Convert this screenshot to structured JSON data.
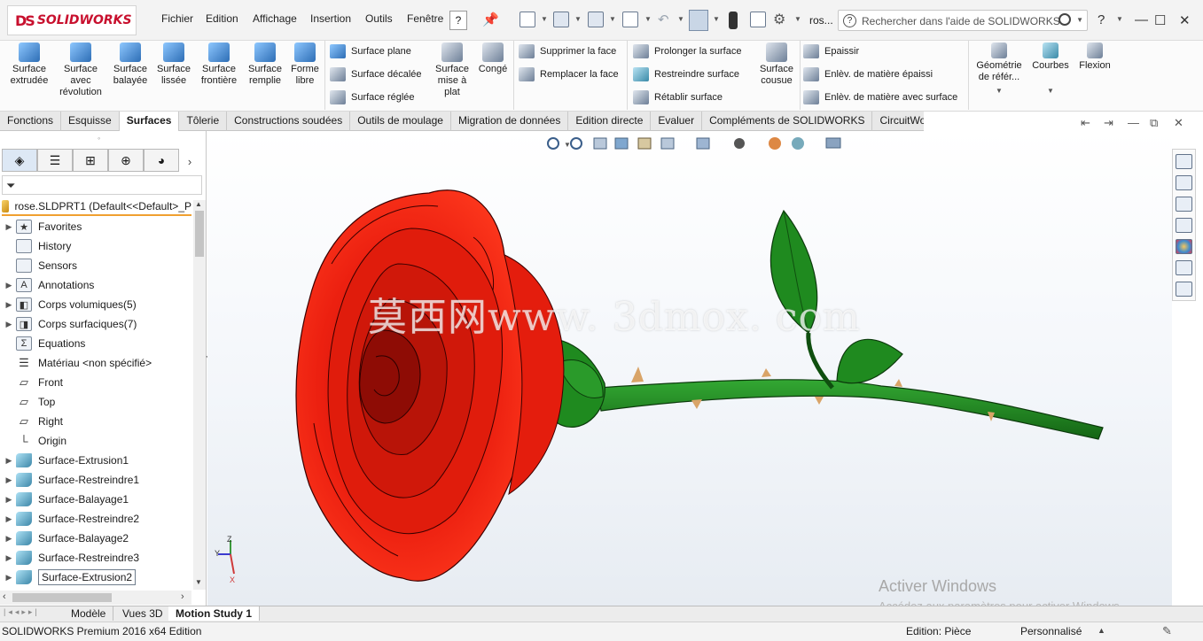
{
  "app": {
    "logo_text": "SOLIDWORKS",
    "logo_mark": "DS"
  },
  "menu": [
    "Fichier",
    "Edition",
    "Affichage",
    "Insertion",
    "Outils",
    "Fenêtre"
  ],
  "titlebar": {
    "help_q": "?",
    "doc_name": "ros...",
    "search_placeholder": "Rechercher dans l'aide de SOLIDWORKS",
    "help_label": "?"
  },
  "commands": {
    "large": [
      {
        "label": "Surface extrudée",
        "icon": "extruded-surface-icon"
      },
      {
        "label": "Surface avec révolution",
        "icon": "revolved-surface-icon"
      },
      {
        "label": "Surface balayée",
        "icon": "swept-surface-icon"
      },
      {
        "label": "Surface lissée",
        "icon": "lofted-surface-icon"
      },
      {
        "label": "Surface frontière",
        "icon": "boundary-surface-icon"
      },
      {
        "label": "Surface remplie",
        "icon": "filled-surface-icon"
      },
      {
        "label": "Forme libre",
        "icon": "freeform-icon"
      }
    ],
    "col1": [
      "Surface plane",
      "Surface décalée",
      "Surface réglée"
    ],
    "flatten_label": "Surface mise à plat",
    "conge_label": "Congé",
    "col2": [
      "Supprimer la face",
      "Remplacer la face"
    ],
    "col3": [
      "Prolonger la surface",
      "Restreindre surface",
      "Rétablir surface"
    ],
    "knit_label": "Surface cousue",
    "col4": [
      "Epaissir",
      "Enlèv. de matière épaissi",
      "Enlèv. de matière avec surface"
    ],
    "ref_geom_label": "Géométrie de référ...",
    "curves_label": "Courbes",
    "flex_label": "Flexion"
  },
  "tabs": [
    {
      "label": "Fonctions",
      "active": false
    },
    {
      "label": "Esquisse",
      "active": false
    },
    {
      "label": "Surfaces",
      "active": true
    },
    {
      "label": "Tôlerie",
      "active": false
    },
    {
      "label": "Constructions soudées",
      "active": false
    },
    {
      "label": "Outils de moulage",
      "active": false
    },
    {
      "label": "Migration de données",
      "active": false
    },
    {
      "label": "Edition directe",
      "active": false
    },
    {
      "label": "Evaluer",
      "active": false
    },
    {
      "label": "Compléments de SOLIDWORKS",
      "active": false
    },
    {
      "label": "CircuitWorks",
      "active": false
    }
  ],
  "tree": {
    "root": "rose.SLDPRT1  (Default<<Default>_P",
    "nodes": [
      {
        "label": "Favorites",
        "icon": "star-folder-icon",
        "expand": true,
        "kind": "box",
        "glyph": "★"
      },
      {
        "label": "History",
        "icon": "history-folder-icon",
        "expand": false,
        "kind": "box",
        "glyph": ""
      },
      {
        "label": "Sensors",
        "icon": "sensor-folder-icon",
        "expand": false,
        "kind": "box",
        "glyph": ""
      },
      {
        "label": "Annotations",
        "icon": "annotation-icon",
        "expand": true,
        "kind": "box",
        "glyph": "A"
      },
      {
        "label": "Corps volumiques(5)",
        "icon": "solid-bodies-icon",
        "expand": true,
        "kind": "box",
        "glyph": "◧"
      },
      {
        "label": "Corps surfaciques(7)",
        "icon": "surface-bodies-icon",
        "expand": true,
        "kind": "box",
        "glyph": "◨"
      },
      {
        "label": "Equations",
        "icon": "equations-icon",
        "expand": false,
        "kind": "box",
        "glyph": "Σ"
      },
      {
        "label": "Matériau <non spécifié>",
        "icon": "material-icon",
        "expand": false,
        "kind": "plain",
        "glyph": "☰"
      },
      {
        "label": "Front",
        "icon": "plane-icon",
        "expand": false,
        "kind": "plain",
        "glyph": "▱"
      },
      {
        "label": "Top",
        "icon": "plane-icon",
        "expand": false,
        "kind": "plain",
        "glyph": "▱"
      },
      {
        "label": "Right",
        "icon": "plane-icon",
        "expand": false,
        "kind": "plain",
        "glyph": "▱"
      },
      {
        "label": "Origin",
        "icon": "origin-icon",
        "expand": false,
        "kind": "plain",
        "glyph": "└"
      },
      {
        "label": "Surface-Extrusion1",
        "icon": "surface-extrude-icon",
        "expand": true,
        "kind": "surf",
        "glyph": ""
      },
      {
        "label": "Surface-Restreindre1",
        "icon": "surface-trim-icon",
        "expand": true,
        "kind": "surf",
        "glyph": ""
      },
      {
        "label": "Surface-Balayage1",
        "icon": "surface-sweep-icon",
        "expand": true,
        "kind": "surf",
        "glyph": ""
      },
      {
        "label": "Surface-Restreindre2",
        "icon": "surface-trim-icon",
        "expand": true,
        "kind": "surf",
        "glyph": ""
      },
      {
        "label": "Surface-Balayage2",
        "icon": "surface-sweep-icon",
        "expand": true,
        "kind": "surf",
        "glyph": ""
      },
      {
        "label": "Surface-Restreindre3",
        "icon": "surface-trim-icon",
        "expand": true,
        "kind": "surf",
        "glyph": ""
      },
      {
        "label": "Surface-Extrusion2",
        "icon": "surface-extrude-icon",
        "expand": true,
        "kind": "surf",
        "glyph": "",
        "selected": true
      }
    ]
  },
  "viewport": {
    "watermark": "莫西网www. 3dmox. com",
    "triad_axes": {
      "x": "X",
      "y": "Y",
      "z": "Z"
    },
    "activate_title": "Activer Windows",
    "activate_sub": "Accédez aux paramètres pour activer Windows.",
    "colors": {
      "petal": "#e8190c",
      "petal_dark": "#9b0d05",
      "stem": "#1e8a1e",
      "stem_dark": "#0f4f0f",
      "thorn": "#d9a468"
    }
  },
  "bottom_tabs": [
    "Modèle",
    "Vues 3D",
    "Motion Study 1"
  ],
  "bottom_active": "Motion Study 1",
  "status": {
    "left": "SOLIDWORKS Premium 2016 x64 Edition",
    "edition": "Edition: Pièce",
    "units": "Personnalisé"
  }
}
